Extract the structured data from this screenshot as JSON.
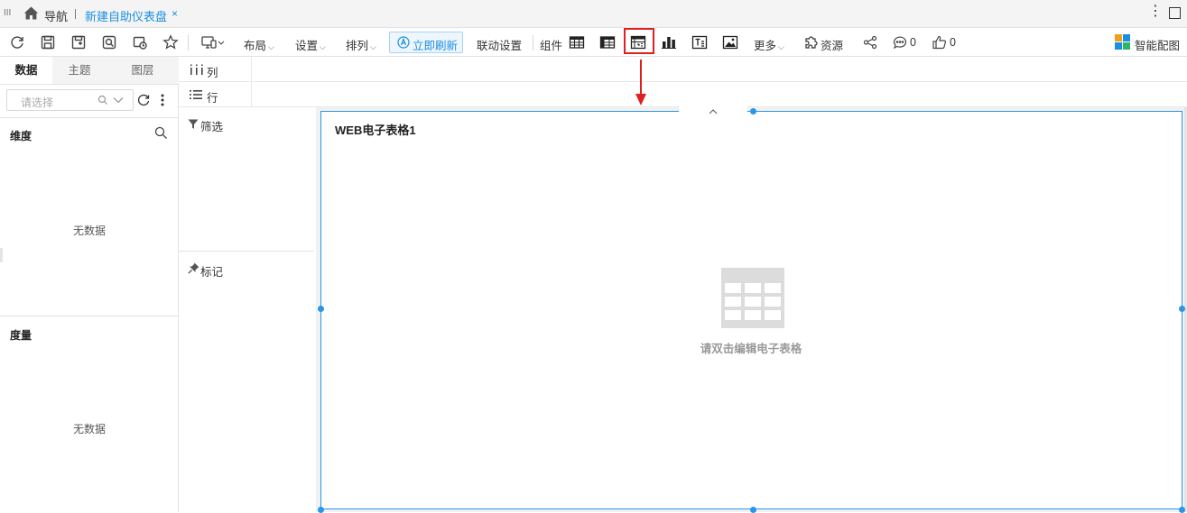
{
  "tabbar": {
    "grip": "III",
    "nav_label": "导航",
    "tab_title": "新建自助仪表盘",
    "close_glyph": "×",
    "menu_glyph": "⋮"
  },
  "toolbar": {
    "layout_label": "布局",
    "settings_label": "设置",
    "arrange_label": "排列",
    "refresh_now_label": "立即刷新",
    "linkage_label": "联动设置",
    "components_label": "组件",
    "more_label": "更多",
    "resources_label": "资源",
    "comment_count": "0",
    "like_count": "0",
    "smart_chart_label": "智能配图",
    "caret_glyph": "⌵",
    "highlight_color": "#e02020"
  },
  "left_panel": {
    "tabs": [
      "数据",
      "主题",
      "图层"
    ],
    "active_tab": "数据",
    "select_placeholder": "请选择",
    "dimension_title": "维度",
    "dimension_empty": "无数据",
    "measure_title": "度量",
    "measure_empty": "无数据"
  },
  "shelves": {
    "columns_label": "列",
    "rows_label": "行",
    "filter_label": "筛选",
    "mark_label": "标记"
  },
  "canvas": {
    "widget_title": "WEB电子表格1",
    "empty_hint": "请双击编辑电子表格",
    "accent_color": "#2b95e8"
  }
}
